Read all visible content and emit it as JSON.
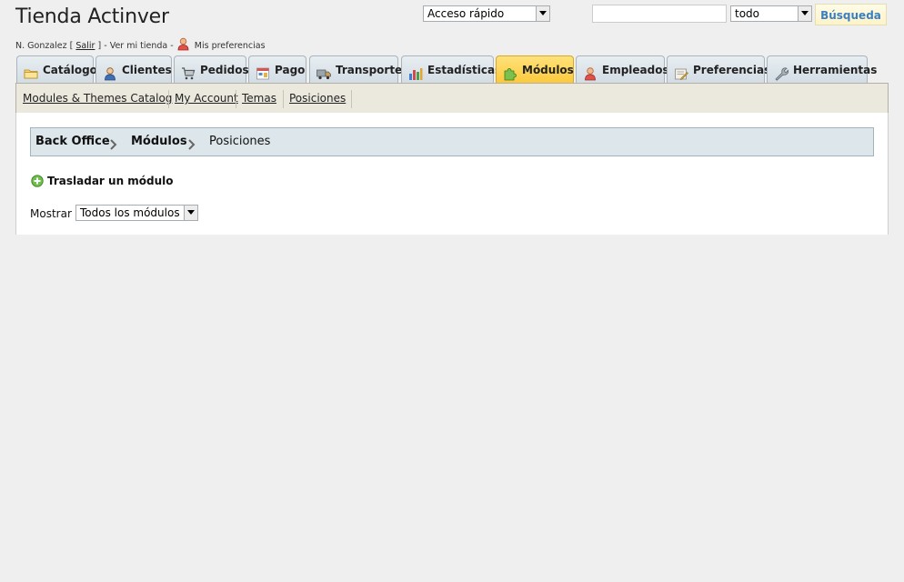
{
  "header": {
    "shop_name": "Tienda Actinver",
    "user_name": "N. Gonzalez",
    "bracket_open": "[",
    "logout": "Salir",
    "bracket_close": "]",
    "dash1": "-",
    "view_shop": "Ver mi tienda",
    "dash2": "-",
    "my_preferences": "Mis preferencias",
    "quick_access": "Acceso rápido",
    "search_value": "",
    "search_scope": "todo",
    "search_button": "Búsqueda"
  },
  "tabs": [
    {
      "label": "Catálogo",
      "icon": "folder-icon",
      "active": false
    },
    {
      "label": "Clientes",
      "icon": "customer-icon",
      "active": false
    },
    {
      "label": "Pedidos",
      "icon": "cart-icon",
      "active": false
    },
    {
      "label": "Pago",
      "icon": "payment-icon",
      "active": false
    },
    {
      "label": "Transporte",
      "icon": "truck-icon",
      "active": false
    },
    {
      "label": "Estadísticas",
      "icon": "bar-chart-icon",
      "active": false
    },
    {
      "label": "Módulos",
      "icon": "puzzle-icon",
      "active": true
    },
    {
      "label": "Empleados",
      "icon": "employee-icon",
      "active": false
    },
    {
      "label": "Preferencias",
      "icon": "preferences-icon",
      "active": false
    },
    {
      "label": "Herramientas",
      "icon": "wrench-icon",
      "active": false
    }
  ],
  "submenu": [
    {
      "label": "Modules & Themes Catalog"
    },
    {
      "label": "My Account"
    },
    {
      "label": "Temas"
    },
    {
      "label": "Posiciones"
    }
  ],
  "breadcrumb": [
    "Back Office",
    "Módulos",
    "Posiciones"
  ],
  "actions": {
    "move_module": "Trasladar un módulo"
  },
  "filter": {
    "label": "Mostrar :",
    "selected": "Todos los módulos"
  },
  "colors": {
    "active_tab": "#fcc93c",
    "tab": "#d3dde4",
    "search_button_text": "#3a7fbf",
    "breadcrumb_bg": "#dde6ea",
    "submenu_bg": "#ebe8de"
  }
}
